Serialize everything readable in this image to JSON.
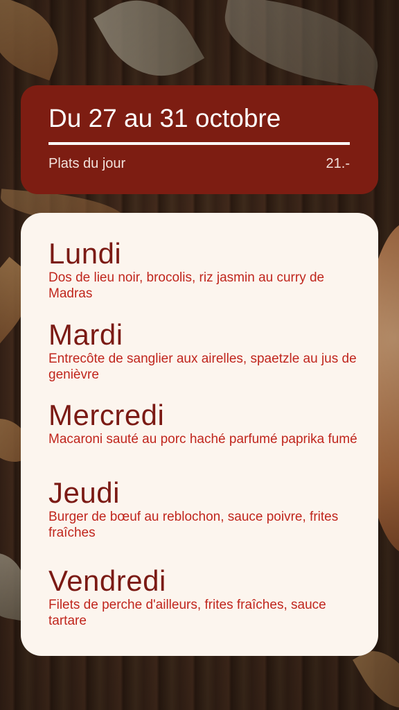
{
  "header": {
    "title": "Du 27 au 31 octobre",
    "subtitle": "Plats du jour",
    "price": "21.-"
  },
  "menu": {
    "days": [
      {
        "name": "Lundi",
        "dish": "Dos de lieu noir, brocolis, riz jasmin au curry de Madras"
      },
      {
        "name": "Mardi",
        "dish": "Entrecôte de sanglier aux airelles, spaetzle au jus de genièvre"
      },
      {
        "name": "Mercredi",
        "dish": "Macaroni sauté au porc haché parfumé paprika fumé"
      },
      {
        "name": "Jeudi",
        "dish": "Burger de bœuf au reblochon, sauce poivre, frites fraîches"
      },
      {
        "name": "Vendredi",
        "dish": "Filets de perche d'ailleurs, frites fraîches, sauce tartare"
      }
    ]
  },
  "colors": {
    "header_bg": "#7d1d12",
    "card_bg": "#fcf5ee",
    "day_name": "#7b1a14",
    "dish_text": "#c0261d"
  }
}
